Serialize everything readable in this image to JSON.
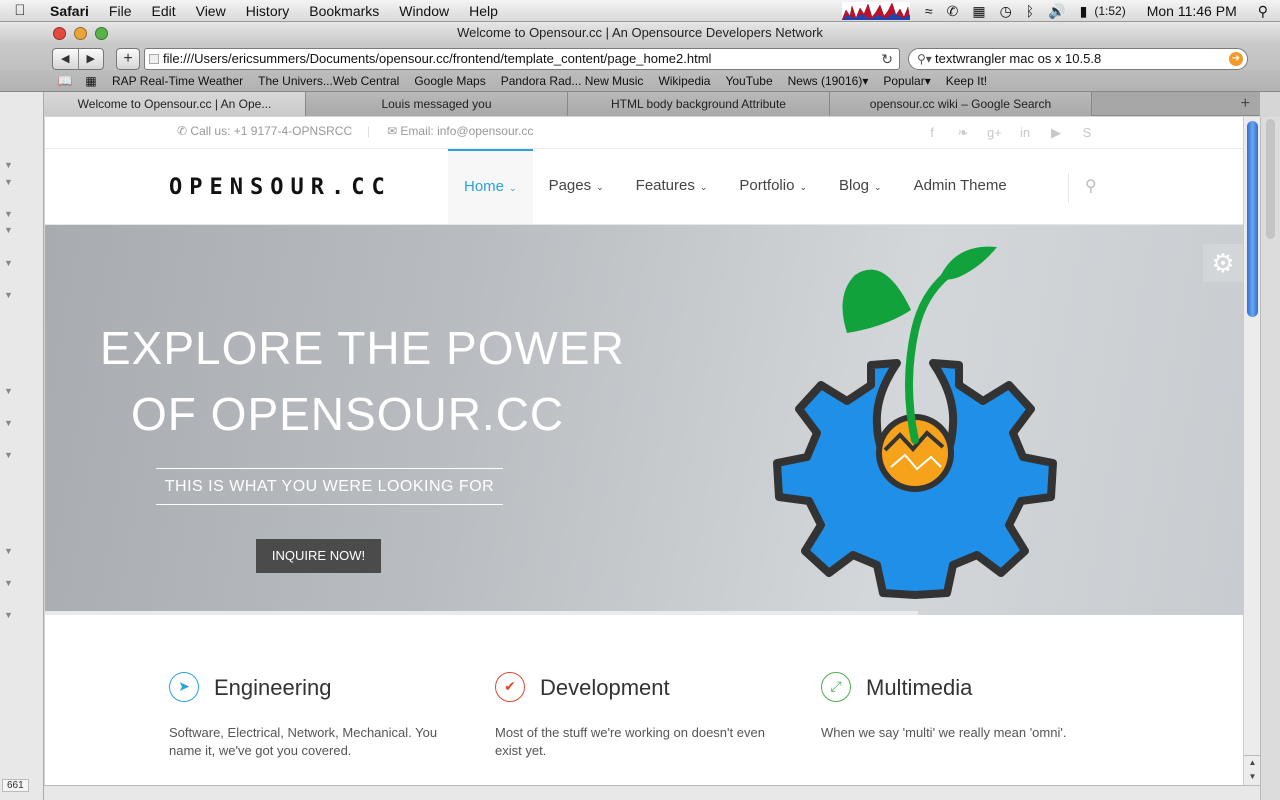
{
  "menubar": {
    "app": "Safari",
    "items": [
      "File",
      "Edit",
      "View",
      "History",
      "Bookmarks",
      "Window",
      "Help"
    ],
    "battery": "(1:52)",
    "clock": "Mon 11:46 PM"
  },
  "window": {
    "title": "Welcome to Opensour.cc | An Opensource Developers Network"
  },
  "toolbar": {
    "url": "file:///Users/ericsummers/Documents/opensour.cc/frontend/template_content/page_home2.html",
    "search": "textwrangler mac os x 10.5.8"
  },
  "bookmarks": [
    "RAP Real-Time Weather",
    "The Univers...Web Central",
    "Google Maps",
    "Pandora Rad... New Music",
    "Wikipedia",
    "YouTube",
    "News (19016)▾",
    "Popular▾",
    "Keep It!"
  ],
  "tabs": [
    "Welcome to Opensour.cc | An Ope...",
    "Louis messaged you",
    "HTML body background Attribute",
    "opensour.cc wiki – Google Search"
  ],
  "leftpane": {
    "line_number": "661"
  },
  "site": {
    "topbar": {
      "call": "Call us: +1 9177-4-OPNSRCC",
      "email": "Email: info@opensour.cc"
    },
    "logo": "OPENSOUR.CC",
    "nav": [
      {
        "label": "Home",
        "dropdown": true
      },
      {
        "label": "Pages",
        "dropdown": true
      },
      {
        "label": "Features",
        "dropdown": true
      },
      {
        "label": "Portfolio",
        "dropdown": true
      },
      {
        "label": "Blog",
        "dropdown": true
      },
      {
        "label": "Admin Theme",
        "dropdown": false
      }
    ],
    "hero": {
      "line1": "EXPLORE THE POWER",
      "line2": "OF OPENSOUR.CC",
      "subtitle": "THIS IS WHAT YOU WERE LOOKING FOR",
      "cta": "INQUIRE NOW!"
    },
    "features": [
      {
        "title": "Engineering",
        "desc": "Software, Electrical, Network, Mechanical. You name it, we've got you covered.",
        "color": "#2aa3d8",
        "icon": "paper-plane-icon"
      },
      {
        "title": "Development",
        "desc": "Most of the stuff we're working on doesn't even exist yet.",
        "color": "#e0492f",
        "icon": "check-icon"
      },
      {
        "title": "Multimedia",
        "desc": "When we say 'multi' we really mean 'omni'.",
        "color": "#4caf50",
        "icon": "compress-icon"
      }
    ]
  },
  "colors": {
    "accent": "#2aa3d8",
    "gear_blue": "#1f8fe8",
    "leaf_green": "#11a23b",
    "seed_orange": "#f7a21b"
  }
}
